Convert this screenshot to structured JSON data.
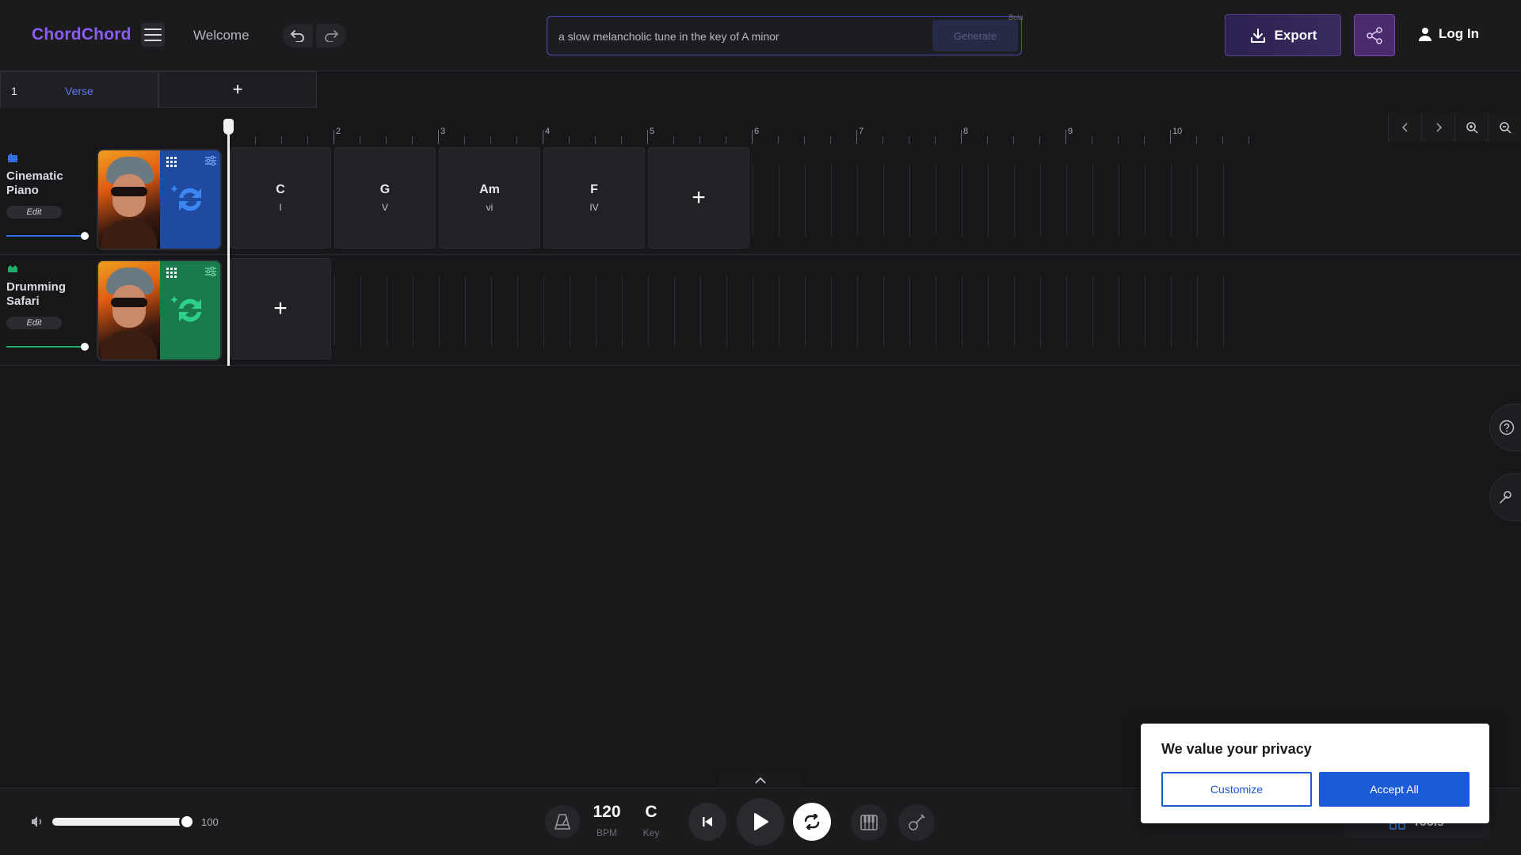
{
  "header": {
    "logo": "ChordChord",
    "welcome": "Welcome",
    "prompt_value": "a slow melancholic tune in the key of A minor",
    "generate_label": "Generate",
    "beta_label": "Beta",
    "export_label": "Export",
    "login_label": "Log In"
  },
  "sections": [
    {
      "number": "1",
      "name": "Verse"
    }
  ],
  "section_add": "+",
  "ruler": {
    "bars": [
      "2",
      "3",
      "4",
      "5",
      "6",
      "7",
      "8",
      "9",
      "10"
    ]
  },
  "tracks": [
    {
      "name": "Cinematic Piano",
      "edit_label": "Edit",
      "accent_color": "#2f6fe0",
      "panel_color": "#1e4aa0",
      "chords": [
        {
          "name": "C",
          "numeral": "I"
        },
        {
          "name": "G",
          "numeral": "V"
        },
        {
          "name": "Am",
          "numeral": "vi"
        },
        {
          "name": "F",
          "numeral": "IV"
        }
      ],
      "add_label": "+"
    },
    {
      "name": "Drumming Safari",
      "edit_label": "Edit",
      "accent_color": "#1fae6a",
      "panel_color": "#1a7a4c",
      "chords": [],
      "add_label": "+"
    }
  ],
  "transport": {
    "volume": "100",
    "bpm": "120",
    "bpm_label": "BPM",
    "key": "C",
    "key_label": "Key",
    "tools_label": "Tools"
  },
  "privacy": {
    "title": "We value your privacy",
    "customize_label": "Customize",
    "accept_label": "Accept All"
  },
  "colors": {
    "brand": "#8b5cf6",
    "section_link": "#5b7be8",
    "privacy_button": "#1b5bd6"
  }
}
